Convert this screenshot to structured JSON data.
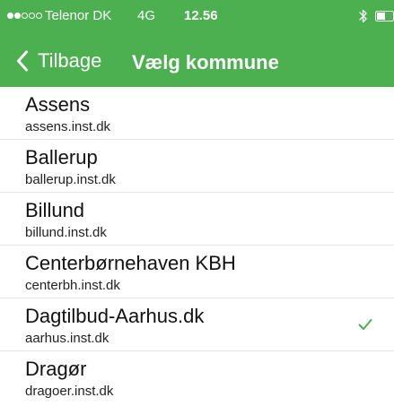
{
  "status_bar": {
    "signal": {
      "filled": 2,
      "total": 5
    },
    "carrier": "Telenor DK",
    "network": "4G",
    "time": "12.56",
    "bluetooth_icon": "bluetooth-icon",
    "battery_icon": "battery-icon"
  },
  "nav": {
    "back_label": "Tilbage",
    "back_icon": "chevron-left-icon",
    "title": "Vælg kommune"
  },
  "municipalities": [
    {
      "name": "Assens",
      "url": "assens.inst.dk",
      "selected": false
    },
    {
      "name": "Ballerup",
      "url": "ballerup.inst.dk",
      "selected": false
    },
    {
      "name": "Billund",
      "url": "billund.inst.dk",
      "selected": false
    },
    {
      "name": "Centerbørnehaven KBH",
      "url": "centerbh.inst.dk",
      "selected": false
    },
    {
      "name": "Dagtilbud-Aarhus.dk",
      "url": "aarhus.inst.dk",
      "selected": true
    },
    {
      "name": "Dragør",
      "url": "dragoer.inst.dk",
      "selected": false
    }
  ],
  "colors": {
    "header_bg": "#4CAF50",
    "header_text": "#FFFFFF",
    "checkmark": "#4CAF50",
    "separator": "#E3E3E3"
  }
}
